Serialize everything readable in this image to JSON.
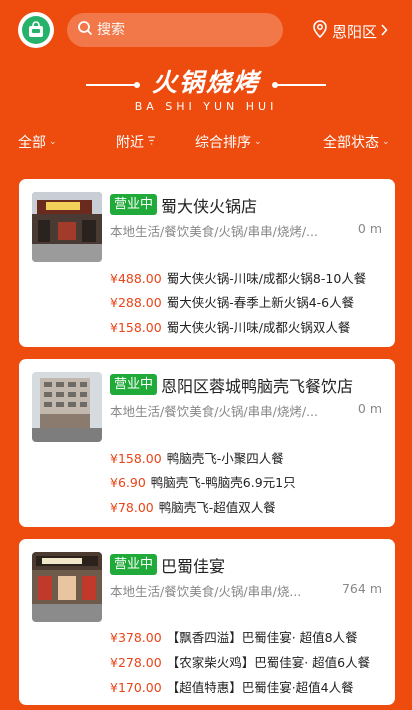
{
  "header": {
    "search_placeholder": "搜索",
    "location": "恩阳区"
  },
  "title": {
    "main": "火锅烧烤",
    "sub": "BA SHI YUN HUI"
  },
  "filters": [
    "全部",
    "附近",
    "综合排序",
    "全部状态"
  ],
  "colors": {
    "brand": "#ee4b0e",
    "open_badge": "#1faa3a",
    "price": "#e94518"
  },
  "cards": [
    {
      "badge": "营业中",
      "name": "蜀大侠火锅店",
      "category": "本地生活/餐饮美食/火锅/串串/烧烤/...",
      "distance": "0 m",
      "deals": [
        {
          "price": "¥488.00",
          "name": "蜀大侠火锅-川味/成都火锅8-10人餐"
        },
        {
          "price": "¥288.00",
          "name": "蜀大侠火锅-春季上新火锅4-6人餐"
        },
        {
          "price": "¥158.00",
          "name": "蜀大侠火锅-川味/成都火锅双人餐"
        }
      ]
    },
    {
      "badge": "营业中",
      "name": "恩阳区蓉城鸭脑壳飞餐饮店",
      "category": "本地生活/餐饮美食/火锅/串串/烧烤/...",
      "distance": "0 m",
      "deals": [
        {
          "price": "¥158.00",
          "name": "鸭脑壳飞-小聚四人餐"
        },
        {
          "price": "¥6.90",
          "name": "鸭脑壳飞-鸭脑壳6.9元1只"
        },
        {
          "price": "¥78.00",
          "name": "鸭脑壳飞-超值双人餐"
        }
      ]
    },
    {
      "badge": "营业中",
      "name": "巴蜀佳宴",
      "category": "本地生活/餐饮美食/火锅/串串/烧...",
      "distance": "764 m",
      "deals": [
        {
          "price": "¥378.00",
          "name": "【飘香四溢】巴蜀佳宴· 超值8人餐"
        },
        {
          "price": "¥278.00",
          "name": "【农家柴火鸡】巴蜀佳宴· 超值6人餐"
        },
        {
          "price": "¥170.00",
          "name": "【超值特惠】巴蜀佳宴·超值4人餐"
        }
      ]
    }
  ]
}
